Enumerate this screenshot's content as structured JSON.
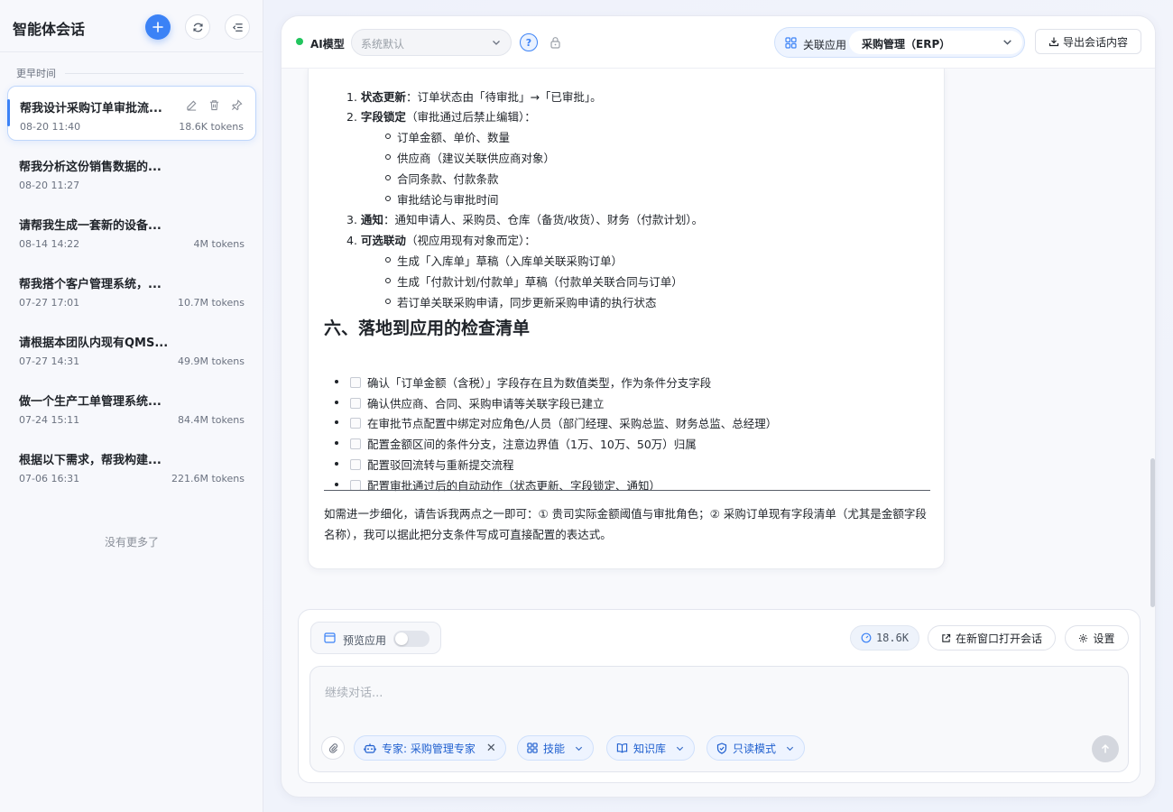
{
  "sidebar": {
    "title": "智能体会话",
    "section_label": "更早时间",
    "no_more": "没有更多了",
    "conversations": [
      {
        "title": "帮我设计采购订单审批流...",
        "date": "08-20 11:40",
        "tokens": "18.6K tokens",
        "active": true
      },
      {
        "title": "帮我分析这份销售数据的...",
        "date": "08-20 11:27",
        "tokens": ""
      },
      {
        "title": "请帮我生成一套新的设备...",
        "date": "08-14 14:22",
        "tokens": "4M tokens"
      },
      {
        "title": "帮我搭个客户管理系统，...",
        "date": "07-27 17:01",
        "tokens": "10.7M tokens"
      },
      {
        "title": "请根据本团队内现有QMS...",
        "date": "07-27 14:31",
        "tokens": "49.9M tokens"
      },
      {
        "title": "做一个生产工单管理系统...",
        "date": "07-24 15:11",
        "tokens": "84.4M tokens"
      },
      {
        "title": "根据以下需求，帮我构建...",
        "date": "07-06 16:31",
        "tokens": "221.6M tokens"
      }
    ]
  },
  "topbar": {
    "model_label": "AI模型",
    "model_value": "系统默认",
    "help_label": "?",
    "app_label": "关联应用",
    "app_value": "采购管理（ERP）",
    "export_label": "导出会话内容"
  },
  "message": {
    "ordered": [
      {
        "num": "1.",
        "bold": "状态更新",
        "text": "：订单状态由「待审批」→「已审批」。"
      },
      {
        "num": "2.",
        "bold": "字段锁定",
        "text": "（审批通过后禁止编辑）："
      },
      {
        "num": "3.",
        "bold": "通知",
        "text": "：通知申请人、采购员、仓库（备货/收货）、财务（付款计划）。"
      },
      {
        "num": "4.",
        "bold": "可选联动",
        "text": "（视应用现有对象而定）："
      }
    ],
    "sub_2": [
      "订单金额、单价、数量",
      "供应商（建议关联供应商对象）",
      "合同条款、付款条款",
      "审批结论与审批时间"
    ],
    "sub_4": [
      "生成「入库单」草稿（入库单关联采购订单）",
      "生成「付款计划/付款单」草稿（付款单关联合同与订单）",
      "若订单关联采购申请，同步更新采购申请的执行状态"
    ],
    "heading": "六、落地到应用的检查清单",
    "checklist": [
      "确认「订单金额（含税）」字段存在且为数值类型，作为条件分支字段",
      "确认供应商、合同、采购申请等关联字段已建立",
      "在审批节点配置中绑定对应角色/人员（部门经理、采购总监、财务总监、总经理）",
      "配置金额区间的条件分支，注意边界值（1万、10万、50万）归属",
      "配置驳回流转与重新提交流程",
      "配置审批通过后的自动动作（状态更新、字段锁定、通知）"
    ],
    "closing": "如需进一步细化，请告诉我两点之一即可：① 贵司实际金额阈值与审批角色；② 采购订单现有字段清单（尤其是金额字段名称），我可以据此把分支条件写成可直接配置的表达式。"
  },
  "composer": {
    "preview_label": "预览应用",
    "preview_enabled": false,
    "token_count": "18.6K",
    "new_window_label": "在新窗口打开会话",
    "settings_label": "设置",
    "placeholder": "继续对话...",
    "chips": {
      "expert": "专家: 采购管理专家",
      "skills": "技能",
      "knowledge": "知识库",
      "mode": "只读模式"
    }
  },
  "colors": {
    "accent": "#3b82f6",
    "online": "#22c55e"
  }
}
